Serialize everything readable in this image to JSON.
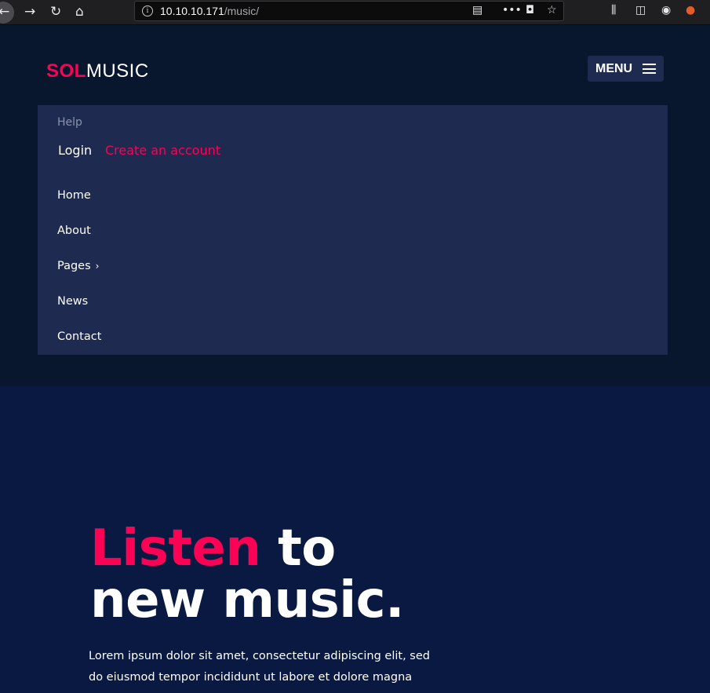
{
  "browser": {
    "url_host": "10.10.10.171",
    "url_path": "/music/"
  },
  "site": {
    "logo_accent": "SOL",
    "logo_rest": "MUSIC",
    "menu_label": "MENU"
  },
  "dropdown": {
    "help": "Help",
    "login": "Login",
    "create_account": "Create an account",
    "items": [
      {
        "label": "Home"
      },
      {
        "label": "About"
      },
      {
        "label": "Pages",
        "chevron": "›"
      },
      {
        "label": "News"
      },
      {
        "label": "Contact"
      }
    ]
  },
  "hero": {
    "title_accent": "Listen",
    "title_rest_1": "to",
    "title_line2": "new music.",
    "body_line1": "Lorem ipsum dolor sit amet, consectetur adipiscing elit, sed",
    "body_line2": "do eiusmod tempor incididunt ut labore et dolore magna"
  },
  "colors": {
    "accent": "#fc0254",
    "header_bg": "#08162e",
    "page_bg": "#0a1942",
    "menu_bg": "#1e2a4f"
  }
}
